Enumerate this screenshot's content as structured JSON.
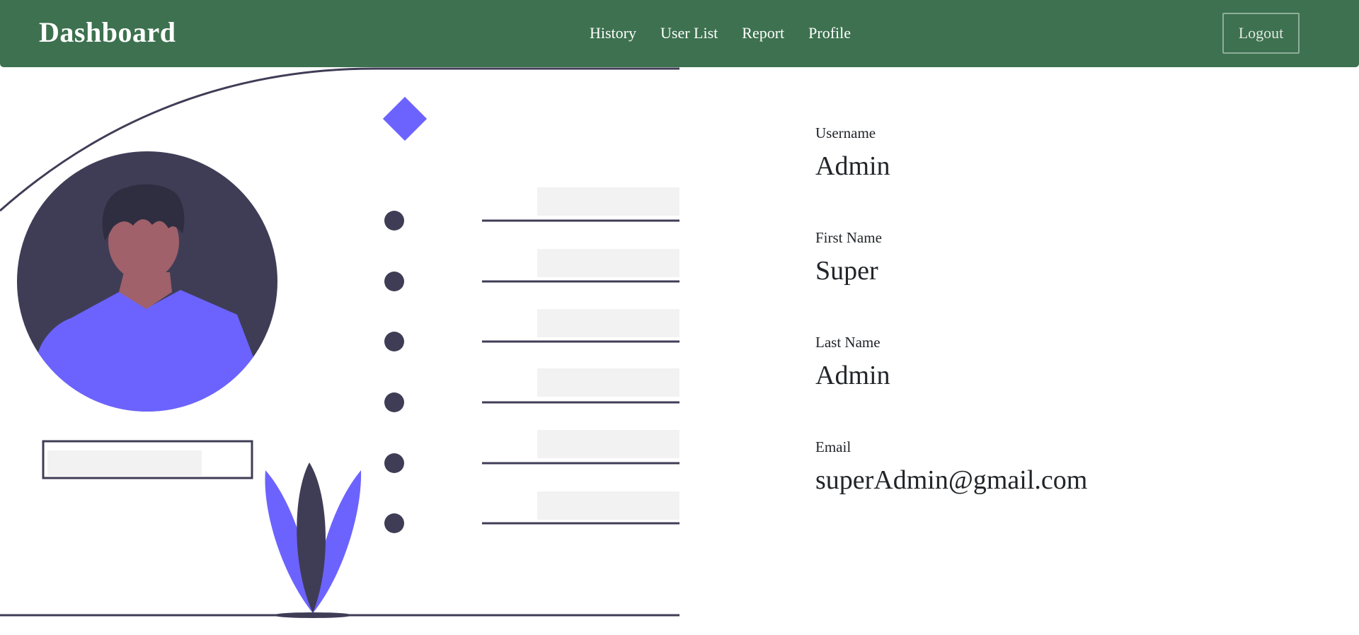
{
  "header": {
    "brand": "Dashboard",
    "nav": [
      {
        "label": "History"
      },
      {
        "label": "User List"
      },
      {
        "label": "Report"
      },
      {
        "label": "Profile"
      }
    ],
    "logout_label": "Logout",
    "background_color": "#3d714f"
  },
  "illustration": {
    "accent_color": "#6c63ff",
    "dark_color": "#3f3d56",
    "skin_color": "#a0616a",
    "placeholder_color": "#f2f2f2"
  },
  "profile": {
    "fields": [
      {
        "label": "Username",
        "value": "Admin"
      },
      {
        "label": "First Name",
        "value": "Super"
      },
      {
        "label": "Last Name",
        "value": "Admin"
      },
      {
        "label": "Email",
        "value": "superAdmin@gmail.com"
      }
    ]
  }
}
